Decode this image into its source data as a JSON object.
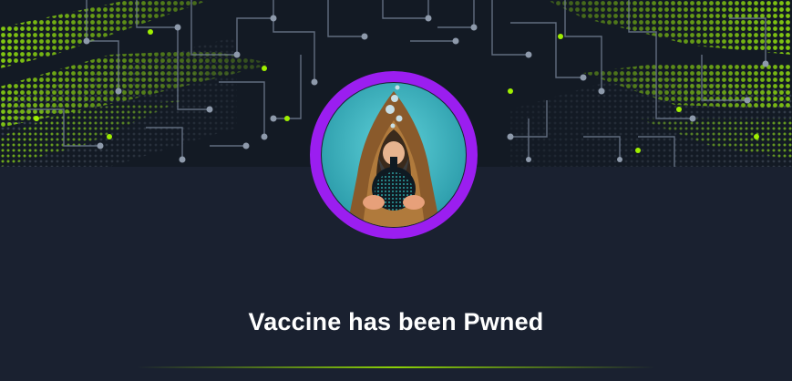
{
  "completion": {
    "title": "Vaccine has been Pwned"
  },
  "colors": {
    "accent_green": "#9fef00",
    "avatar_ring": "#9b1ef0",
    "background": "#1a2130",
    "banner_bg": "#131a24"
  },
  "icons": {
    "avatar": "hooded-alchemist-avatar",
    "banner": "circuit-board-banner"
  }
}
